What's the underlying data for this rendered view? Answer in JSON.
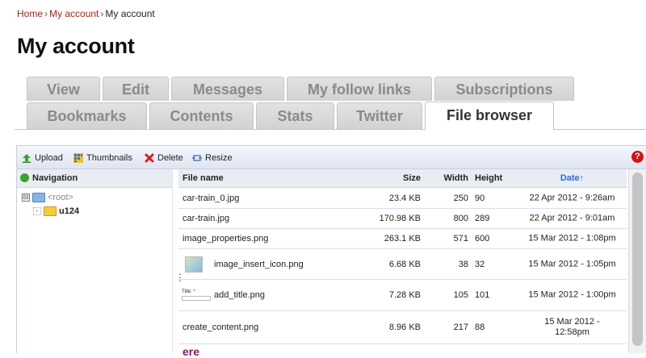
{
  "breadcrumb": {
    "home": "Home",
    "sep1": "›",
    "account_link": "My account",
    "sep2": "›",
    "current": "My account"
  },
  "page_title": "My account",
  "tabs": {
    "row1": [
      "View",
      "Edit",
      "Messages",
      "My follow links",
      "Subscriptions"
    ],
    "row2": [
      "Bookmarks",
      "Contents",
      "Stats",
      "Twitter",
      "File browser"
    ],
    "active": "File browser"
  },
  "toolbar": {
    "upload": "Upload",
    "thumbnails": "Thumbnails",
    "delete": "Delete",
    "resize": "Resize",
    "help": "?"
  },
  "navigation": {
    "header": "Navigation",
    "root_label": "<root>",
    "folder_label": "u124",
    "root_expander": "⊟",
    "folder_expander": "·"
  },
  "files": {
    "headers": {
      "name": "File name",
      "size": "Size",
      "width": "Width",
      "height": "Height",
      "date": "Date↑"
    },
    "rows": [
      {
        "name": "car-train_0.jpg",
        "size": "23.4 KB",
        "width": "250",
        "height": "90",
        "date": "22 Apr 2012 - 9:26am"
      },
      {
        "name": "car-train.jpg",
        "size": "170.98 KB",
        "width": "800",
        "height": "289",
        "date": "22 Apr 2012 - 9:01am"
      },
      {
        "name": "image_properties.png",
        "size": "263.1 KB",
        "width": "571",
        "height": "600",
        "date": "15 Mar 2012 - 1:08pm"
      },
      {
        "name": "image_insert_icon.png",
        "size": "6.68 KB",
        "width": "38",
        "height": "32",
        "date": "15 Mar 2012 - 1:05pm"
      },
      {
        "name": "add_title.png",
        "size": "7.28 KB",
        "width": "105",
        "height": "101",
        "date": "15 Mar 2012 - 1:00pm",
        "thumb_text": "Title:",
        "thumb_req": "*"
      },
      {
        "name": "create_content.png",
        "size": "8.96 KB",
        "width": "217",
        "height": "88",
        "date_line1": "15 Mar 2012 -",
        "date_line2": "12:58pm"
      }
    ]
  },
  "bottom_peek": "ere",
  "colors": {
    "link": "#a1281c",
    "date_header": "#2672d1",
    "help": "#d41414",
    "tab_bg": "#d9d9d9"
  },
  "splitter_glyph": "⋮"
}
